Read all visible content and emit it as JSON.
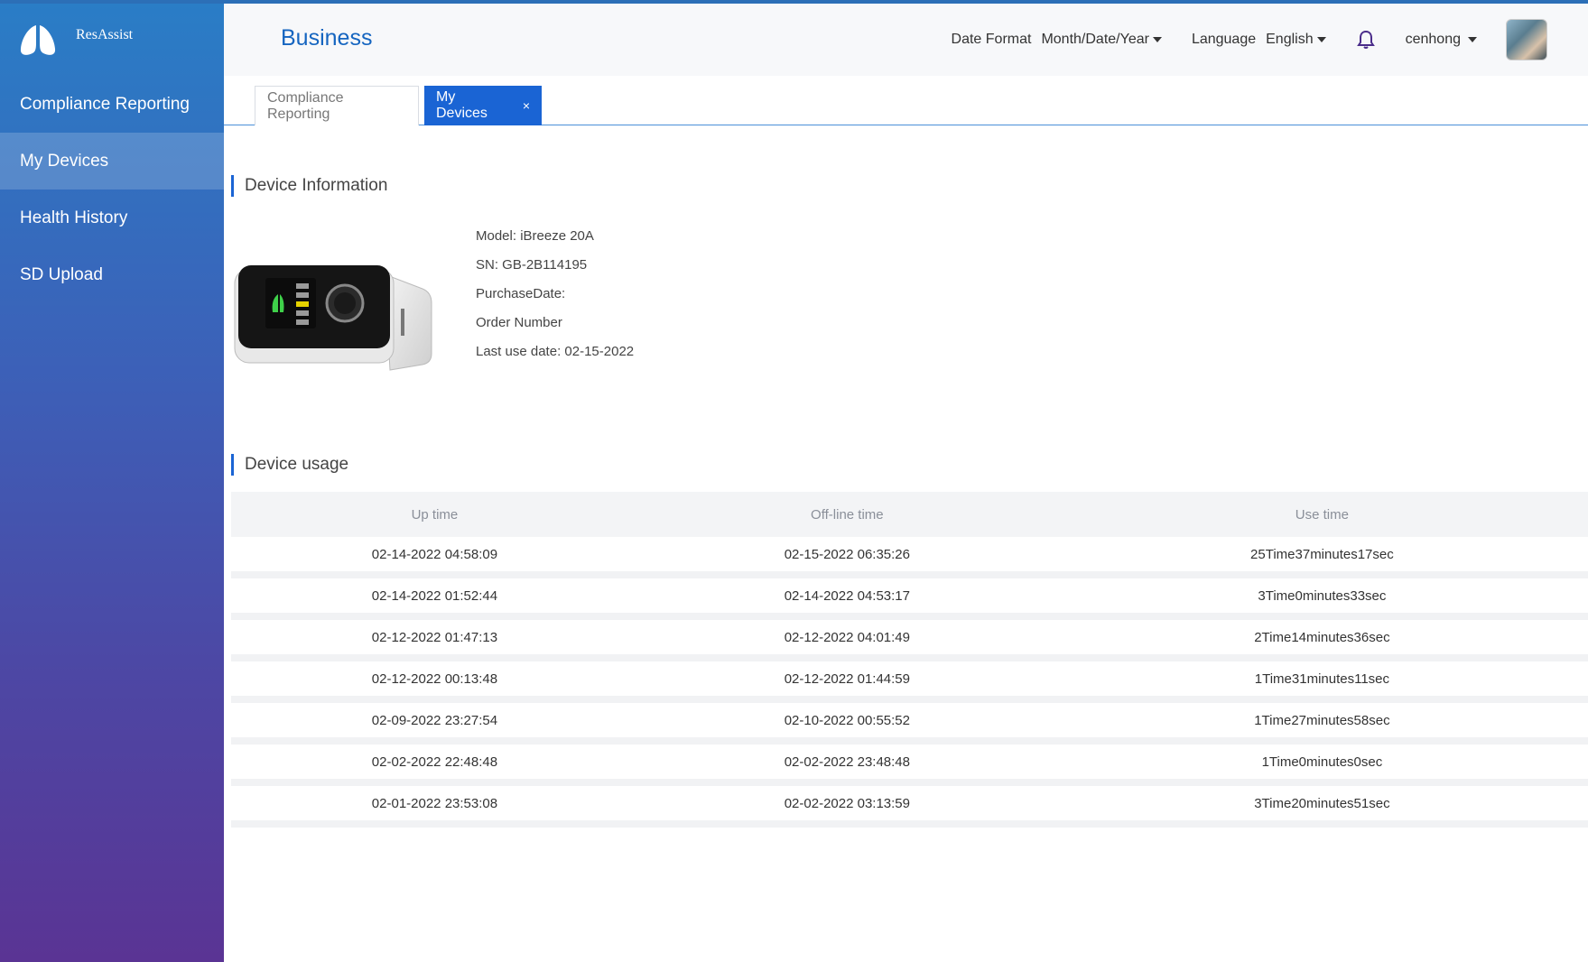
{
  "brand": {
    "name": "ResAssist"
  },
  "sidebar": {
    "items": [
      {
        "label": "Compliance Reporting",
        "active": false
      },
      {
        "label": "My Devices",
        "active": true
      },
      {
        "label": "Health History",
        "active": false
      },
      {
        "label": "SD Upload",
        "active": false
      }
    ]
  },
  "header": {
    "title": "Business",
    "date_format_label": "Date Format",
    "date_format_value": "Month/Date/Year",
    "language_label": "Language",
    "language_value": "English",
    "username": "cenhong"
  },
  "tabs": [
    {
      "label": "Compliance Reporting",
      "active": false
    },
    {
      "label": "My Devices",
      "active": true,
      "closable": true,
      "close_icon": "×"
    }
  ],
  "device_info": {
    "section_title": "Device Information",
    "model": "Model: iBreeze 20A",
    "sn": "SN: GB-2B114195",
    "purchase_date": "PurchaseDate:",
    "order_number": "Order Number",
    "last_use_date": "Last use date: 02-15-2022"
  },
  "device_usage": {
    "section_title": "Device usage",
    "columns": [
      "Up time",
      "Off-line time",
      "Use time"
    ],
    "rows": [
      [
        "02-14-2022 04:58:09",
        "02-15-2022 06:35:26",
        "25Time37minutes17sec"
      ],
      [
        "02-14-2022 01:52:44",
        "02-14-2022 04:53:17",
        "3Time0minutes33sec"
      ],
      [
        "02-12-2022 01:47:13",
        "02-12-2022 04:01:49",
        "2Time14minutes36sec"
      ],
      [
        "02-12-2022 00:13:48",
        "02-12-2022 01:44:59",
        "1Time31minutes11sec"
      ],
      [
        "02-09-2022 23:27:54",
        "02-10-2022 00:55:52",
        "1Time27minutes58sec"
      ],
      [
        "02-02-2022 22:48:48",
        "02-02-2022 23:48:48",
        "1Time0minutes0sec"
      ],
      [
        "02-01-2022 23:53:08",
        "02-02-2022 03:13:59",
        "3Time20minutes51sec"
      ]
    ]
  },
  "colors": {
    "accent": "#1a64d4",
    "title_blue": "#1565c0",
    "sidebar_top": "#2a7dc6",
    "sidebar_bottom": "#5a3494"
  },
  "icons": {
    "logo": "lungs-logo-icon",
    "bell": "bell-icon",
    "caret": "caret-down-icon",
    "close": "close-icon"
  }
}
